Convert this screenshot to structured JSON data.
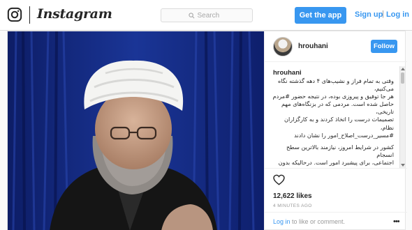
{
  "header": {
    "brand_name": "Instagram",
    "search_placeholder": "Search",
    "get_app_label": "Get the app",
    "signup_label": "Sign up",
    "separator": "|",
    "login_label": "Log in"
  },
  "post": {
    "username": "hrouhani",
    "follow_label": "Follow",
    "caption_username": "hrouhani",
    "caption_paragraphs": [
      "وقتی به تمام فراز و نشیب‌های ۴ دهه گذشته نگاه می‌کنیم،\nهر جا توفیق و پیروزی بوده، در نتیجه حضور #مردم\nحاصل شده است. مردمی که در بزنگاه‌های مهم تاریخی،\nتصمیمات درست را اتخاذ کردند و به کارگزاران نظام،\n#مسیر_درست_اصلاح_امور را نشان دادند",
      "کشور در شرایط امروز، نیازمند بالاترین سطح انسجام\nاجتماعی، برای پیشبرد امور است. درحالیکه بدون #انسجام\nو همکاری نهادها و تریبون‌های مختلف، نمی‌توان انتظار\nداشت که #اعتماد عموم مردم به \"حاکمیت\" افزایش پیدا\nکند"
    ],
    "likes_text": "12,622 likes",
    "time_ago": "4 MINUTES AGO",
    "comment_prompt": {
      "login_link": "Log in",
      "rest": " to like or comment."
    },
    "more_options": "•••"
  },
  "colors": {
    "accent": "#3897f0",
    "text": "#262626",
    "muted": "#999999",
    "border": "#dbdbdb",
    "photo_bg": "#12267a"
  },
  "icons": {
    "logo": "instagram-glyph-icon",
    "search": "search-icon",
    "like": "heart-icon"
  }
}
